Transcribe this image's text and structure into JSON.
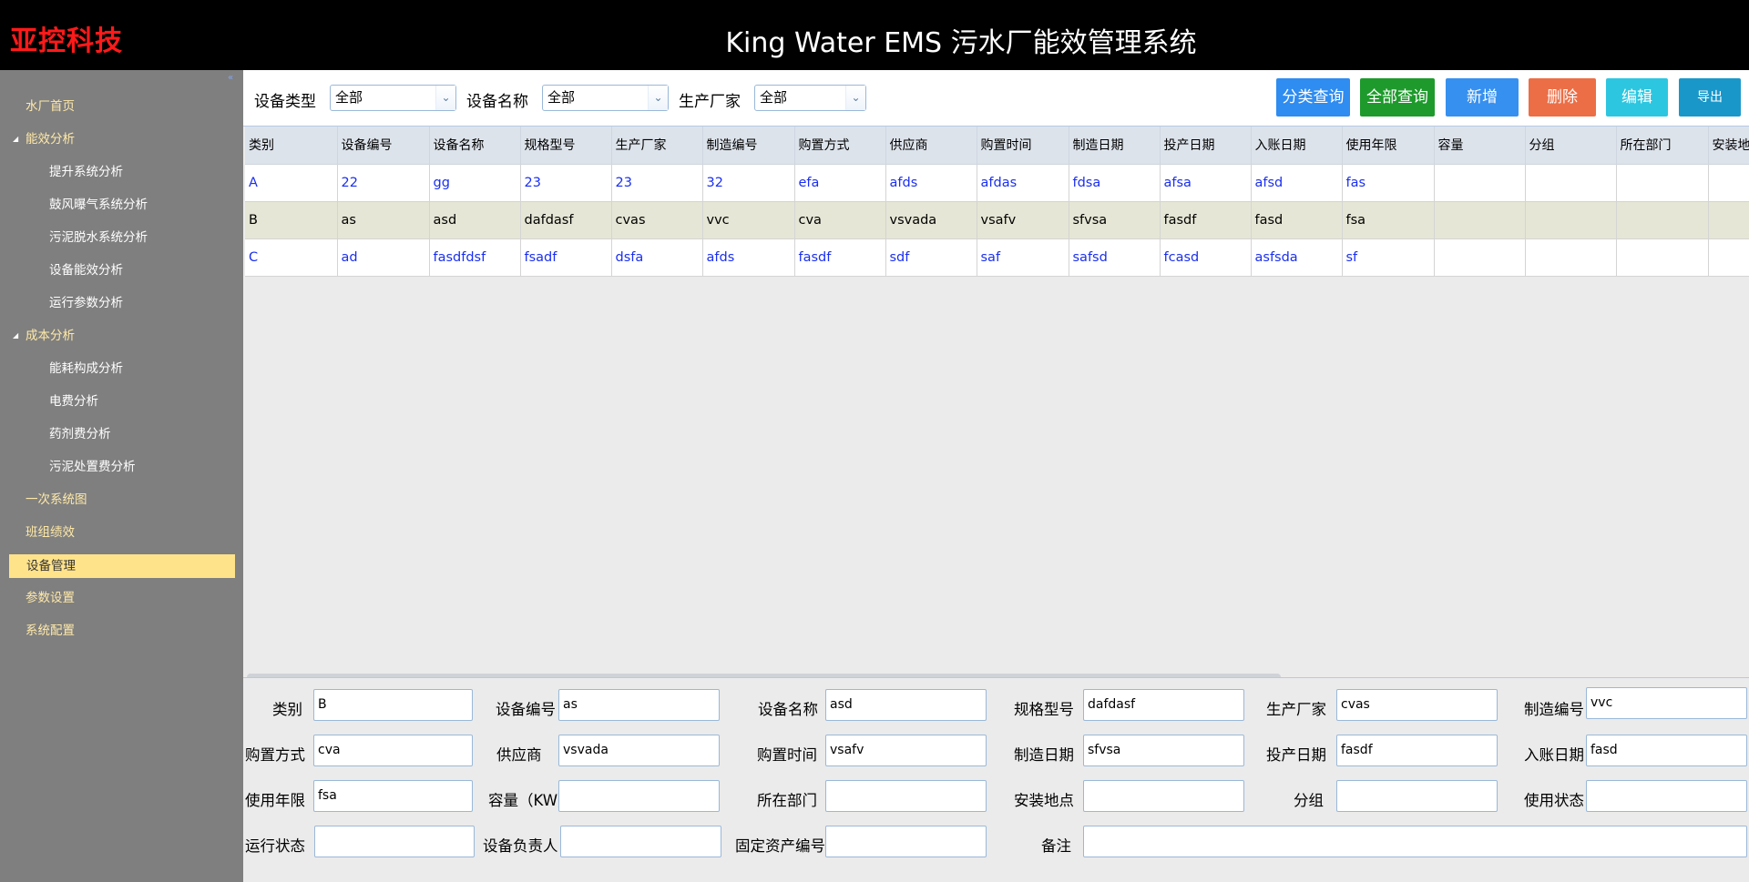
{
  "header": {
    "brand": "亚控科技",
    "title": "King Water EMS 污水厂能效管理系统"
  },
  "sidebar": {
    "items": [
      {
        "label": "水厂首页"
      },
      {
        "label": "能效分析"
      },
      {
        "label": "提升系统分析"
      },
      {
        "label": "鼓风曝气系统分析"
      },
      {
        "label": "污泥脱水系统分析"
      },
      {
        "label": "设备能效分析"
      },
      {
        "label": "运行参数分析"
      },
      {
        "label": "成本分析"
      },
      {
        "label": "能耗构成分析"
      },
      {
        "label": "电费分析"
      },
      {
        "label": "药剂费分析"
      },
      {
        "label": "污泥处置费分析"
      },
      {
        "label": "一次系统图"
      },
      {
        "label": "班组绩效"
      },
      {
        "label": "设备管理"
      },
      {
        "label": "参数设置"
      },
      {
        "label": "系统配置"
      }
    ],
    "active": "设备管理"
  },
  "filters": {
    "type_label": "设备类型",
    "type_value": "全部",
    "name_label": "设备名称",
    "name_value": "全部",
    "maker_label": "生产厂家",
    "maker_value": "全部"
  },
  "buttons": {
    "category_query": "分类查询",
    "all_query": "全部查询",
    "add": "新增",
    "delete": "删除",
    "edit": "编辑",
    "export": "导出"
  },
  "table": {
    "columns": [
      "类别",
      "设备编号",
      "设备名称",
      "规格型号",
      "生产厂家",
      "制造编号",
      "购置方式",
      "供应商",
      "购置时间",
      "制造日期",
      "投产日期",
      "入账日期",
      "使用年限",
      "容量",
      "分组",
      "所在部门",
      "安装地点"
    ],
    "rows": [
      [
        "A",
        "22",
        "gg",
        "23",
        "23",
        "32",
        "efa",
        "afds",
        "afdas",
        "fdsa",
        "afsa",
        "afsd",
        "fas",
        "",
        "",
        "",
        ""
      ],
      [
        "B",
        "as",
        "asd",
        "dafdasf",
        "cvas",
        "vvc",
        "cva",
        "vsvada",
        "vsafv",
        "sfvsa",
        "fasdf",
        "fasd",
        "fsa",
        "",
        "",
        "",
        ""
      ],
      [
        "C",
        "ad",
        "fasdfdsf",
        "fsadf",
        "dsfa",
        "afds",
        "fasdf",
        "sdf",
        "saf",
        "safsd",
        "fcasd",
        "asfsda",
        "sf",
        "",
        "",
        "",
        ""
      ]
    ]
  },
  "form": {
    "category": {
      "label": "类别",
      "value": "B"
    },
    "device_no": {
      "label": "设备编号",
      "value": "as"
    },
    "device_name": {
      "label": "设备名称",
      "value": "asd"
    },
    "spec": {
      "label": "规格型号",
      "value": "dafdasf"
    },
    "maker": {
      "label": "生产厂家",
      "value": "cvas"
    },
    "mfg_no": {
      "label": "制造编号",
      "value": "vvc"
    },
    "purchase_mode": {
      "label": "购置方式",
      "value": "cva"
    },
    "supplier": {
      "label": "供应商",
      "value": "vsvada"
    },
    "purchase_time": {
      "label": "购置时间",
      "value": "vsafv"
    },
    "mfg_date": {
      "label": "制造日期",
      "value": "sfvsa"
    },
    "commission_date": {
      "label": "投产日期",
      "value": "fasdf"
    },
    "booking_date": {
      "label": "入账日期",
      "value": "fasd"
    },
    "service_life": {
      "label": "使用年限",
      "value": "fsa"
    },
    "capacity": {
      "label": "容量（KW）",
      "value": ""
    },
    "department": {
      "label": "所在部门",
      "value": ""
    },
    "install_location": {
      "label": "安装地点",
      "value": ""
    },
    "group": {
      "label": "分组",
      "value": ""
    },
    "use_status": {
      "label": "使用状态",
      "value": ""
    },
    "run_status": {
      "label": "运行状态",
      "value": ""
    },
    "owner": {
      "label": "设备负责人",
      "value": ""
    },
    "asset_no": {
      "label": "固定资产编号",
      "value": ""
    },
    "remark": {
      "label": "备注",
      "value": ""
    }
  },
  "colors": {
    "brand": "#ff1a1a",
    "btn_category": "#2f8cf0",
    "btn_all": "#1e9a2c",
    "btn_add": "#3690f0",
    "btn_delete": "#ec6e46",
    "btn_edit": "#2cc6e0",
    "btn_export": "#1a97c9",
    "active_nav": "#ffe38a"
  }
}
